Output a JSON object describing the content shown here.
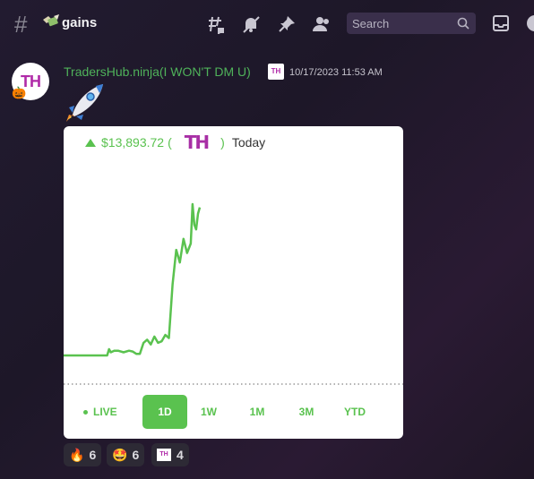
{
  "header": {
    "channel_name": "gains",
    "search_placeholder": "Search"
  },
  "message": {
    "username": "TradersHub.ninja(I WON'T DM U)",
    "timestamp": "10/17/2023 11:53 AM",
    "avatar_text": "TH",
    "badge_text": "TH"
  },
  "embed": {
    "price": "$13,893.72",
    "open_paren": "(",
    "close_paren": ")",
    "logo_text": "TH",
    "period": "Today",
    "tabs": [
      "LIVE",
      "1D",
      "1W",
      "1M",
      "3M",
      "YTD"
    ],
    "active_tab": "1D"
  },
  "reactions": [
    {
      "emoji": "🔥",
      "count": "6"
    },
    {
      "emoji": "🤩",
      "count": "6"
    },
    {
      "emoji": "TH",
      "count": "4"
    }
  ],
  "colors": {
    "accent_green": "#5ac24f",
    "username_green": "#4fb25a",
    "brand_magenta": "#a82fa5"
  },
  "chart_data": {
    "type": "line",
    "x": [
      0,
      6,
      12,
      18,
      24,
      30,
      36,
      42,
      48,
      50,
      52,
      56,
      60,
      66,
      72,
      76,
      80,
      84,
      88,
      92,
      96,
      100,
      104,
      108,
      112,
      116,
      120,
      124,
      128,
      132,
      136,
      140,
      142,
      144,
      146,
      148,
      150
    ],
    "y": [
      0,
      0,
      0,
      0,
      0,
      0,
      0,
      0,
      0,
      0.4,
      0.2,
      0.3,
      0.3,
      0.2,
      0.3,
      0.25,
      0.1,
      0.1,
      0.8,
      1.0,
      0.7,
      1.2,
      0.8,
      0.9,
      1.3,
      1.1,
      4.5,
      6.7,
      5.9,
      7.4,
      6.5,
      7.1,
      9.6,
      8.3,
      8.0,
      9.0,
      9.4
    ],
    "ylim": [
      0,
      10
    ],
    "baseline": 0.7,
    "series": [
      {
        "values": []
      }
    ]
  }
}
